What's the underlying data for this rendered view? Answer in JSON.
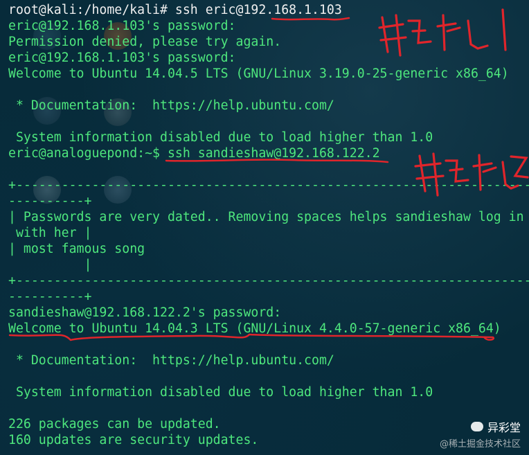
{
  "terminal": {
    "lines": [
      "root@kali:/home/kali# ssh eric@192.168.1.103",
      "eric@192.168.1.103's password:",
      "Permission denied, please try again.",
      "eric@192.168.1.103's password:",
      "Welcome to Ubuntu 14.04.5 LTS (GNU/Linux 3.19.0-25-generic x86_64)",
      "",
      " * Documentation:  https://help.ubuntu.com/",
      "",
      " System information disabled due to load higher than 1.0",
      "eric@analoguepond:~$ ssh sandieshaw@192.168.122.2",
      "",
      "+------------------------------------------------------------------------",
      "----------+",
      "| Passwords are very dated.. Removing spaces helps sandieshaw log in",
      " with her |",
      "| most famous song",
      "          |",
      "+------------------------------------------------------------------------",
      "----------+",
      "sandieshaw@192.168.122.2's password:",
      "Welcome to Ubuntu 14.04.3 LTS (GNU/Linux 4.4.0-57-generic x86_64)",
      "",
      " * Documentation:  https://help.ubuntu.com/",
      "",
      " System information disabled due to load higher than 1.0",
      "",
      "226 packages can be updated.",
      "160 updates are security updates."
    ]
  },
  "annotations": {
    "label1": "靶机1",
    "label2": "靶机2"
  },
  "watermark": {
    "brand": "异彩堂",
    "sub": "@稀土掘金技术社区"
  },
  "colors": {
    "terminal_text": "#4ee77d",
    "prompt_text": "#f0f0f0",
    "annotation_red": "#e0252b",
    "background": "#072b3a"
  }
}
